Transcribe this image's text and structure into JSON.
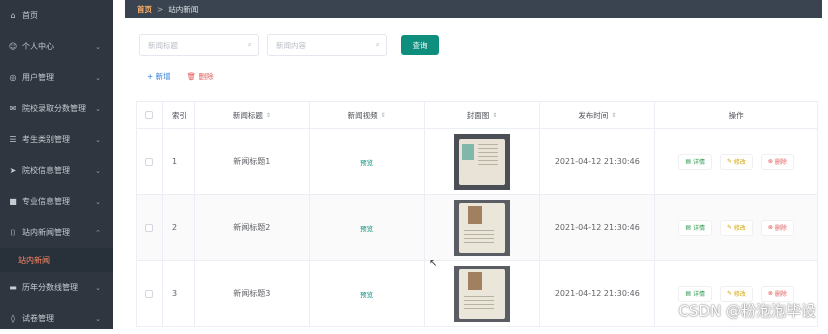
{
  "sidebar": {
    "items": [
      {
        "icon": "home-icon",
        "glyph": "⌂",
        "label": "首页",
        "chevron": false
      },
      {
        "icon": "user-icon",
        "glyph": "☺",
        "label": "个人中心",
        "chevron": true
      },
      {
        "icon": "users-icon",
        "glyph": "◎",
        "label": "用户管理",
        "chevron": true
      },
      {
        "icon": "mail-icon",
        "glyph": "✉",
        "label": "院校录取分数管理",
        "chevron": true
      },
      {
        "icon": "filter-icon",
        "glyph": "☰",
        "label": "考生类别管理",
        "chevron": true
      },
      {
        "icon": "send-icon",
        "glyph": "➤",
        "label": "院校信息管理",
        "chevron": true
      },
      {
        "icon": "delete-icon",
        "glyph": "■",
        "label": "专业信息管理",
        "chevron": true
      },
      {
        "icon": "news-icon",
        "glyph": "⌷",
        "label": "站内新闻管理",
        "chevron": true,
        "expanded": true
      }
    ],
    "sub_item": "站内新闻",
    "items_after": [
      {
        "icon": "chart-icon",
        "glyph": "▬",
        "label": "历年分数线管理",
        "chevron": true
      },
      {
        "icon": "paper-icon",
        "glyph": "◊",
        "label": "试卷管理",
        "chevron": true
      }
    ]
  },
  "breadcrumb": {
    "home": "首页",
    "separator": ">",
    "current": "站内新闻"
  },
  "search": {
    "title_placeholder": "新闻标题",
    "content_placeholder": "新闻内容",
    "query_label": "查询"
  },
  "actions": {
    "add_label": "+ 新增",
    "delete_label": "删除"
  },
  "table": {
    "headers": {
      "index": "索引",
      "title": "新闻标题",
      "video": "新闻视频",
      "cover": "封面图",
      "time": "发布时间",
      "ops": "操作"
    },
    "rows": [
      {
        "index": "1",
        "title": "新闻标题1",
        "video": "预览",
        "time": "2021-04-12 21:30:46"
      },
      {
        "index": "2",
        "title": "新闻标题2",
        "video": "预览",
        "time": "2021-04-12 21:30:46"
      },
      {
        "index": "3",
        "title": "新闻标题3",
        "video": "预览",
        "time": "2021-04-12 21:30:46"
      }
    ],
    "op_labels": {
      "detail": "详情",
      "edit": "修改",
      "remove": "删除"
    }
  },
  "watermark": "CSDN @粉泡泡毕设",
  "colors": {
    "sidebar_bg": "#2f3640",
    "accent": "#0e8f7e",
    "active_sub": "#ff8a65",
    "danger": "#e05c5c"
  }
}
